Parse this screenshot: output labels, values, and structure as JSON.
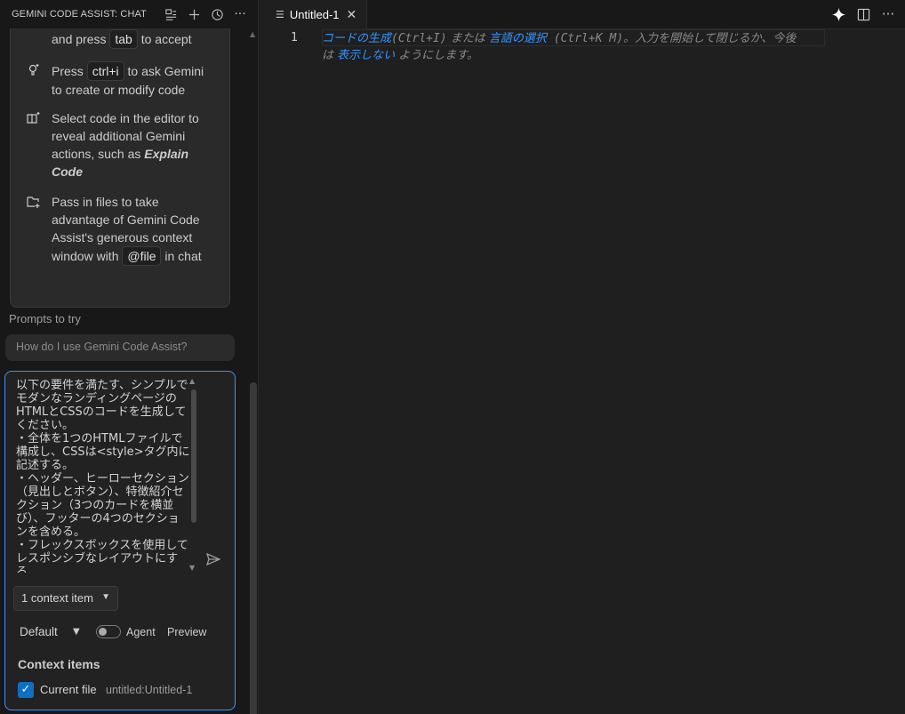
{
  "panel": {
    "title": "GEMINI CODE ASSIST: CHAT",
    "actions": [
      "edit-chat-icon",
      "new-chat-icon",
      "history-icon",
      "more-icon"
    ]
  },
  "tips": [
    {
      "icon": "inline-suggest-icon",
      "pre": "and press ",
      "key": "tab",
      "post": " to accept"
    },
    {
      "icon": "lightbulb-sparkle-icon",
      "pre": "Press ",
      "key": "ctrl+i",
      "post": " to ask Gemini to create or modify code"
    },
    {
      "icon": "book-sparkle-icon",
      "pre": "Select code in the editor to reveal additional Gemini actions, such as ",
      "emph": "Explain Code"
    },
    {
      "icon": "folder-add-icon",
      "pre": "Pass in files to take advantage of Gemini Code Assist's generous context window with ",
      "key": "@file",
      "post": " in chat"
    }
  ],
  "prompts": {
    "label": "Prompts to try",
    "items": [
      "How do I use Gemini Code Assist?"
    ]
  },
  "chat_input": {
    "value": "以下の要件を満たす、シンプルでモダンなランディングページのHTMLとCSSのコードを生成してください。\n・全体を1つのHTMLファイルで構成し、CSSは<style>タグ内に記述する。\n・ヘッダー、ヒーローセクション（見出しとボタン）、特徴紹介セクション（3つのカードを横並び）、フッターの4つのセクションを含める。\n・フレックスボックスを使用してレスポンシブなレイアウトにする。"
  },
  "context_dropdown": "1 context item",
  "mode": {
    "selected": "Default",
    "agent_label": "Agent",
    "preview_label": "Preview",
    "agent_enabled": false
  },
  "context_items": {
    "title": "Context items",
    "items": [
      {
        "label": "Current file",
        "file": "untitled:Untitled-1",
        "checked": true
      }
    ]
  },
  "editor": {
    "tab_label": "Untitled-1",
    "line_number": "1",
    "hint": {
      "link1": "コードの生成",
      "key1": "(Ctrl+I)",
      "mid": " または ",
      "link2": "言語の選択",
      "key2": " (Ctrl+K M)",
      "tail": "。入力を開始して閉じるか、今後",
      "line2_pre": "は ",
      "link3": "表示しない",
      "line2_post": " ようにします。"
    },
    "actions": [
      "gemini-sparkle-icon",
      "split-editor-icon",
      "more-icon"
    ]
  },
  "colors": {
    "accent": "#3794ff",
    "checkbox": "#0e70c0"
  }
}
